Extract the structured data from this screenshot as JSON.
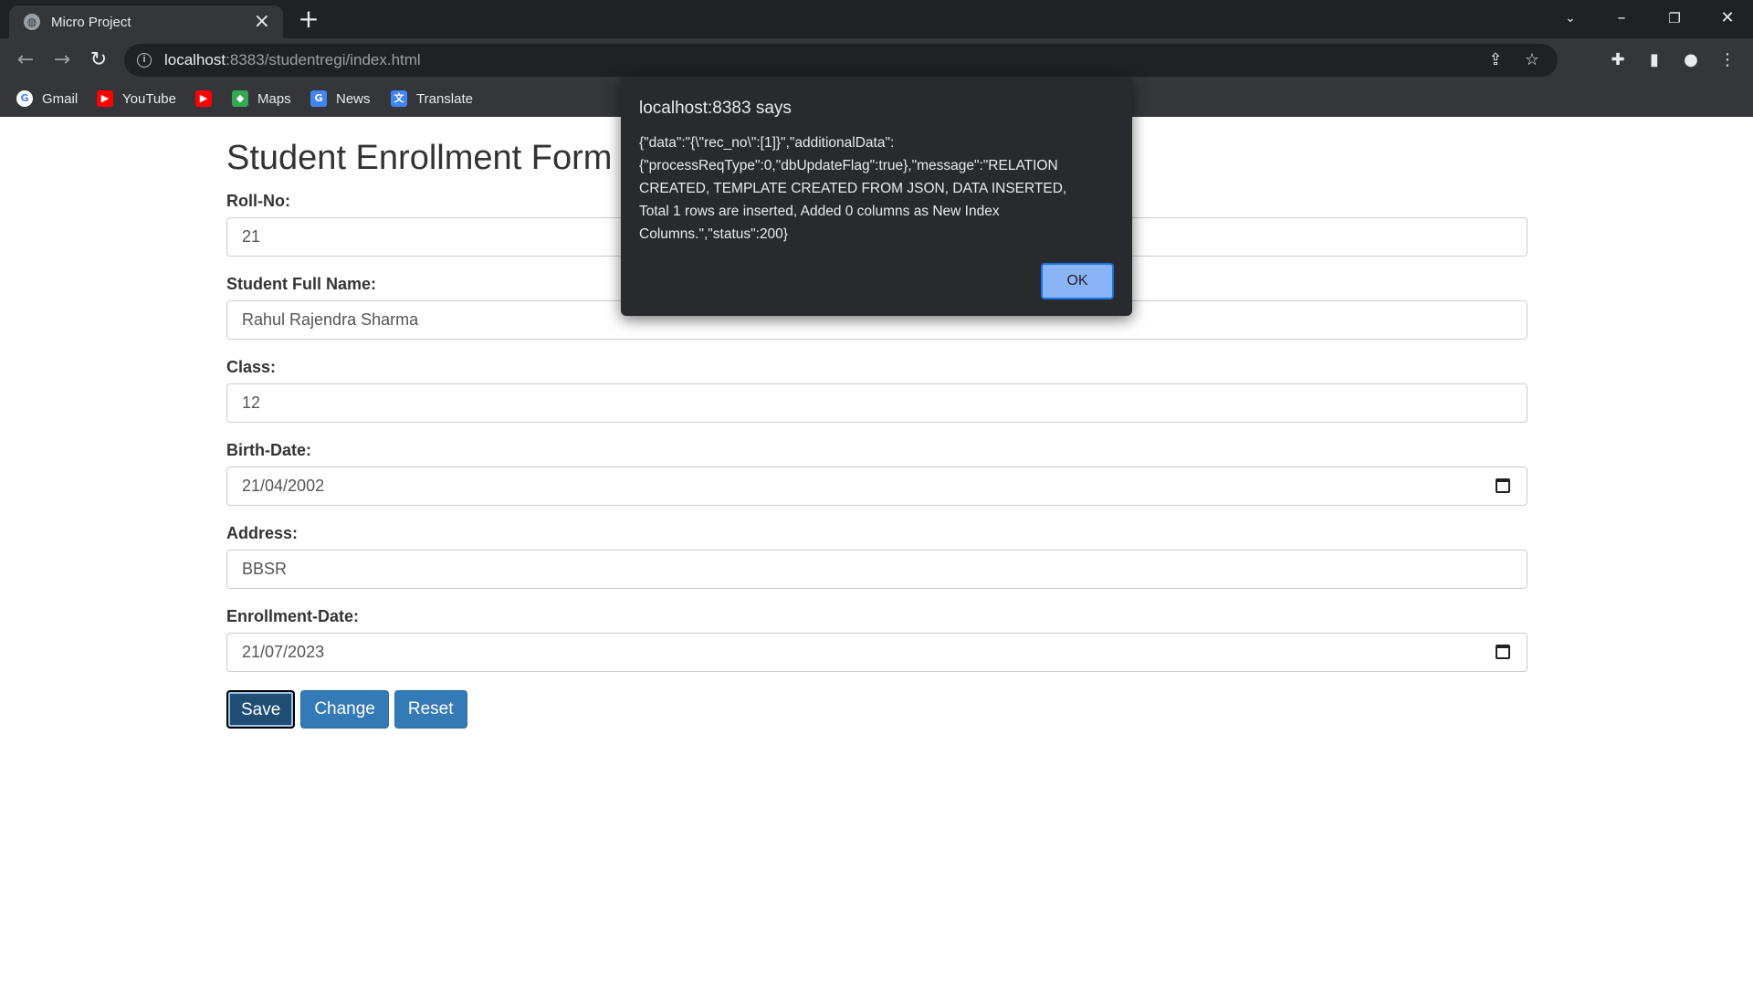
{
  "browser": {
    "tab_title": "Micro Project",
    "url_host": "localhost",
    "url_rest": ":8383/studentregi/index.html"
  },
  "bookmarks": [
    {
      "label": "Gmail",
      "icon": "google-icon"
    },
    {
      "label": "YouTube",
      "icon": "youtube-icon"
    },
    {
      "label": "",
      "icon": "youtube-icon"
    },
    {
      "label": "Maps",
      "icon": "maps-icon"
    },
    {
      "label": "News",
      "icon": "news-icon"
    },
    {
      "label": "Translate",
      "icon": "translate-icon"
    }
  ],
  "form": {
    "title": "Student Enrollment Form",
    "fields": [
      {
        "label": "Roll-No:",
        "value": "21"
      },
      {
        "label": "Student Full Name:",
        "value": "Rahul Rajendra Sharma"
      },
      {
        "label": "Class:",
        "value": "12"
      },
      {
        "label": "Birth-Date:",
        "value": "21/04/2002"
      },
      {
        "label": "Address:",
        "value": "BBSR"
      },
      {
        "label": "Enrollment-Date:",
        "value": "21/07/2023"
      }
    ],
    "buttons": {
      "save": "Save",
      "change": "Change",
      "reset": "Reset"
    }
  },
  "dialog": {
    "title": "localhost:8383 says",
    "message": "{\"data\":\"{\\\"rec_no\\\":[1]}\",\"additionalData\":{\"processReqType\":0,\"dbUpdateFlag\":true},\"message\":\"RELATION CREATED, TEMPLATE CREATED FROM JSON, DATA INSERTED, Total 1 rows are inserted, Added 0 columns as New Index Columns.\",\"status\":200}",
    "ok_label": "OK"
  },
  "colors": {
    "chrome_dark": "#202124",
    "chrome_mid": "#35363a",
    "button_blue": "#337ab7",
    "dialog_bg": "#292a2d",
    "dialog_ok": "#8ab4f8"
  }
}
